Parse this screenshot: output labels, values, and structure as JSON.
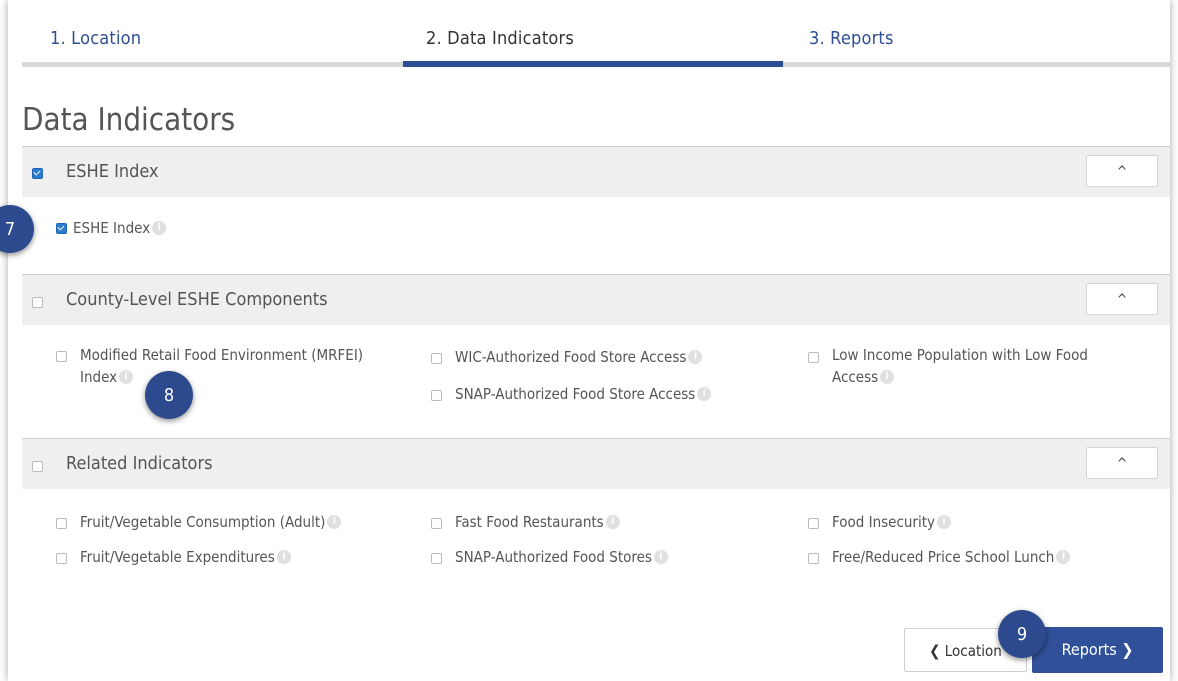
{
  "tabs": [
    {
      "label": "1. Location"
    },
    {
      "label": "2. Data Indicators"
    },
    {
      "label": "3. Reports"
    }
  ],
  "page_title": "Data Indicators",
  "sections": [
    {
      "title": "ESHE Index",
      "checked": true,
      "items": [
        {
          "label": "ESHE Index",
          "checked": true
        }
      ]
    },
    {
      "title": "County-Level ESHE Components",
      "checked": false,
      "items": [
        {
          "label": "Modified Retail Food Environment (MRFEI)",
          "label_line2": "Index"
        },
        {
          "label": "WIC-Authorized Food Store Access"
        },
        {
          "label": "SNAP-Authorized Food Store Access"
        },
        {
          "label": "Low Income Population with Low Food",
          "label_line2": "Access"
        }
      ]
    },
    {
      "title": "Related Indicators",
      "checked": false,
      "items": [
        {
          "label": "Fruit/Vegetable Consumption (Adult)"
        },
        {
          "label": "Fruit/Vegetable Expenditures"
        },
        {
          "label": "Fast Food Restaurants"
        },
        {
          "label": "SNAP-Authorized Food Stores"
        },
        {
          "label": "Food Insecurity"
        },
        {
          "label": "Free/Reduced Price School Lunch"
        }
      ]
    }
  ],
  "collapse_glyph": "^",
  "badges": [
    "7",
    "8",
    "9"
  ],
  "nav": {
    "back_label": "Location",
    "next_label": "Reports"
  },
  "colors": {
    "accent": "#2e4e92",
    "checkbox_checked": "#2a7bd0",
    "section_bg": "#efefef"
  }
}
